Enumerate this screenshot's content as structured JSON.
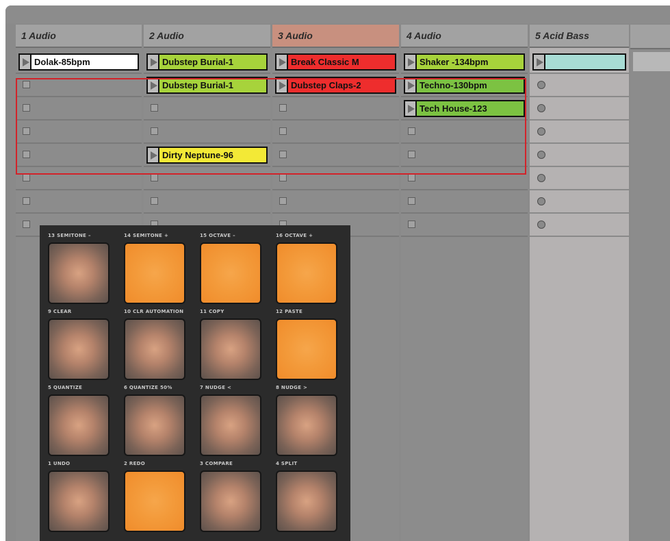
{
  "tracks": [
    {
      "name": "1 Audio",
      "header_color": "#a2a2a2"
    },
    {
      "name": "2 Audio",
      "header_color": "#a2a2a2"
    },
    {
      "name": "3 Audio",
      "header_color": "#c8907f"
    },
    {
      "name": "4 Audio",
      "header_color": "#a2a2a2"
    },
    {
      "name": "5 Acid Bass",
      "header_color": "#a2a2a2"
    }
  ],
  "clips": {
    "track1": [
      "Dolak-85bpm"
    ],
    "track2": [
      "Dubstep Burial-1",
      "Dubstep Burial-1",
      "Dirty Neptune-96"
    ],
    "track3": [
      "Break Classic M",
      "Dubstep Claps-2"
    ],
    "track4": [
      "Shaker -134bpm",
      "Techno-130bpm",
      "Tech House-123"
    ],
    "track5": [
      ""
    ]
  },
  "clip_colors": {
    "white": "#ffffff",
    "lime": "#a7d33b",
    "red": "#ee2d2d",
    "green": "#7cc242",
    "yellow": "#f3e936",
    "teal": "#a8dcd4"
  },
  "highlight_color": "#d2232a",
  "pads": [
    {
      "label": "13 SEMITONE –",
      "state": "off"
    },
    {
      "label": "14 SEMITONE +",
      "state": "on"
    },
    {
      "label": "15 OCTAVE –",
      "state": "on"
    },
    {
      "label": "16 OCTAVE +",
      "state": "on"
    },
    {
      "label": "9 CLEAR",
      "state": "off"
    },
    {
      "label": "10 CLR AUTOMATION",
      "state": "off"
    },
    {
      "label": "11 COPY",
      "state": "off"
    },
    {
      "label": "12 PASTE",
      "state": "on"
    },
    {
      "label": "5 QUANTIZE",
      "state": "off"
    },
    {
      "label": "6 QUANTIZE 50%",
      "state": "off"
    },
    {
      "label": "7 NUDGE <",
      "state": "off"
    },
    {
      "label": "8 NUDGE >",
      "state": "off"
    },
    {
      "label": "1 UNDO",
      "state": "off"
    },
    {
      "label": "2 REDO",
      "state": "on"
    },
    {
      "label": "3 COMPARE",
      "state": "off"
    },
    {
      "label": "4 SPLIT",
      "state": "off"
    }
  ],
  "icons": [
    "play-icon",
    "stop-icon",
    "record-arm-icon"
  ]
}
